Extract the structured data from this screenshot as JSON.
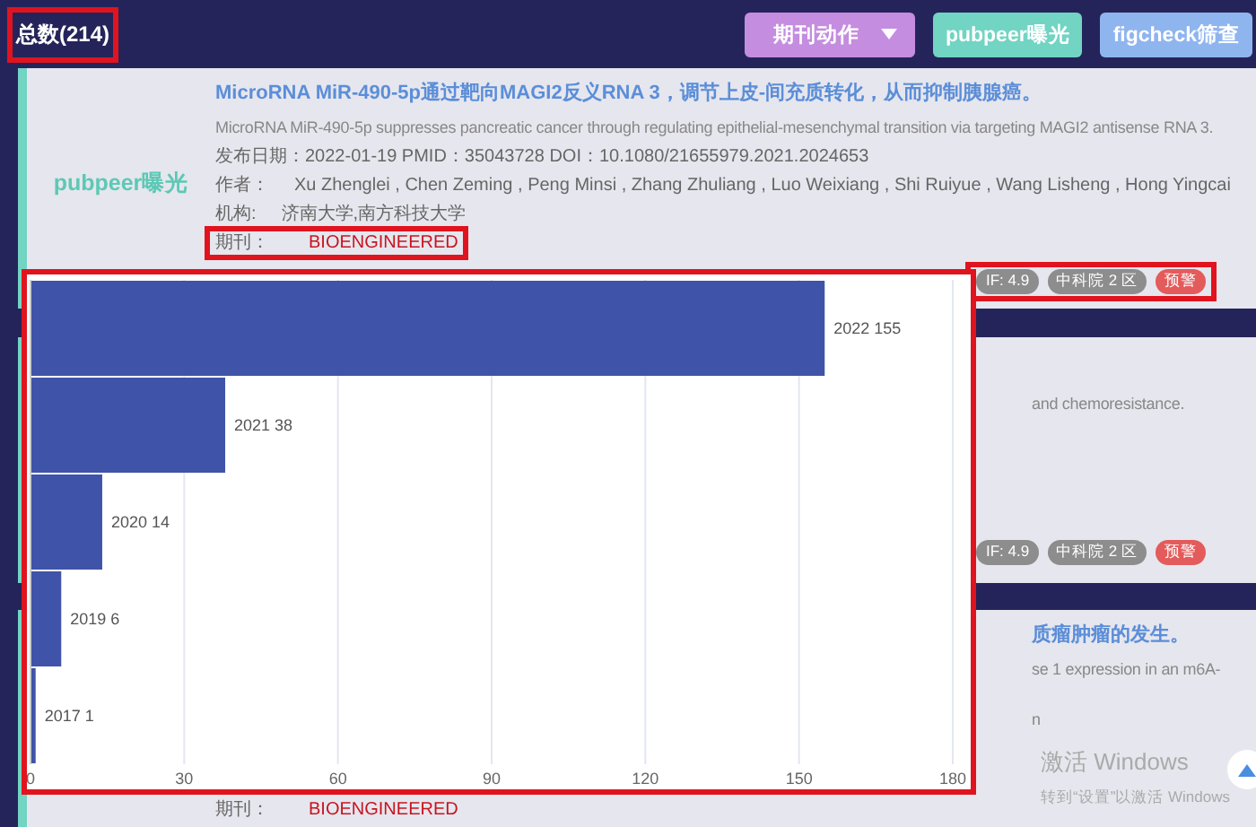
{
  "header": {
    "total": {
      "text": "总数(214)",
      "highlighted": true
    },
    "buttons": [
      {
        "label": "期刊动作",
        "kind": "dropdown",
        "color": "#c48ddf"
      },
      {
        "label": "pubpeer曝光",
        "kind": "plain",
        "color": "#72d4c3"
      },
      {
        "label": "figcheck筛查",
        "kind": "plain",
        "color": "#8fb5ef"
      }
    ]
  },
  "papers": [
    {
      "side_label": "pubpeer曝光",
      "title": "MicroRNA MiR-490-5p通过靶向MAGI2反义RNA 3，调节上皮-间充质转化，从而抑制胰腺癌。",
      "abstract": "MicroRNA MiR-490-5p suppresses pancreatic cancer through regulating epithelial-mesenchymal transition via targeting MAGI2 antisense RNA 3.",
      "meta": "发布日期：2022-01-19    PMID：35043728    DOI：10.1080/21655979.2021.2024653",
      "authors_label": "作者：",
      "authors": "Xu Zhenglei , Chen Zeming , Peng Minsi , Zhang Zhuliang , Luo Weixiang , Shi Ruiyue , Wang Lisheng , Hong Yingcai",
      "org_label": "机构:",
      "org": "济南大学,南方科技大学",
      "journal_label": "期刊：",
      "journal": "BIOENGINEERED",
      "journal_highlighted": true,
      "badges": [
        {
          "text": "IF: 4.9",
          "kind": "info"
        },
        {
          "text": "中科院 2 区",
          "kind": "info"
        },
        {
          "text": "预警",
          "kind": "warn"
        }
      ],
      "badges_highlighted": true
    },
    {
      "abstract": "and chemoresistance.",
      "badges": [
        {
          "text": "IF: 4.9",
          "kind": "info"
        },
        {
          "text": "中科院 2 区",
          "kind": "info"
        },
        {
          "text": "预警",
          "kind": "warn"
        }
      ],
      "badges_highlighted": false
    },
    {
      "title": "质瘤肿瘤的发生。",
      "abstract": "se 1 expression in an m6A-",
      "abstract_2": "n",
      "journal_label": "期刊：",
      "journal": "BIOENGINEERED",
      "journal_highlighted": false
    }
  ],
  "chart": {
    "highlighted": true,
    "chart_data": {
      "type": "bar",
      "orientation": "horizontal",
      "categories": [
        "2022",
        "2021",
        "2020",
        "2019",
        "2017"
      ],
      "series": [
        {
          "color": "#3f53a8",
          "values": [
            155,
            38,
            14,
            6,
            1
          ]
        }
      ],
      "xlim": [
        0,
        180
      ],
      "xticks": [
        0,
        30,
        60,
        90,
        120,
        150,
        180
      ],
      "grid": true,
      "value_labels": [
        "155",
        "38",
        "14",
        "6",
        "1"
      ]
    }
  },
  "os_notice": {
    "title": "激活 Windows",
    "text": "转到“设置”以激活 Windows"
  }
}
